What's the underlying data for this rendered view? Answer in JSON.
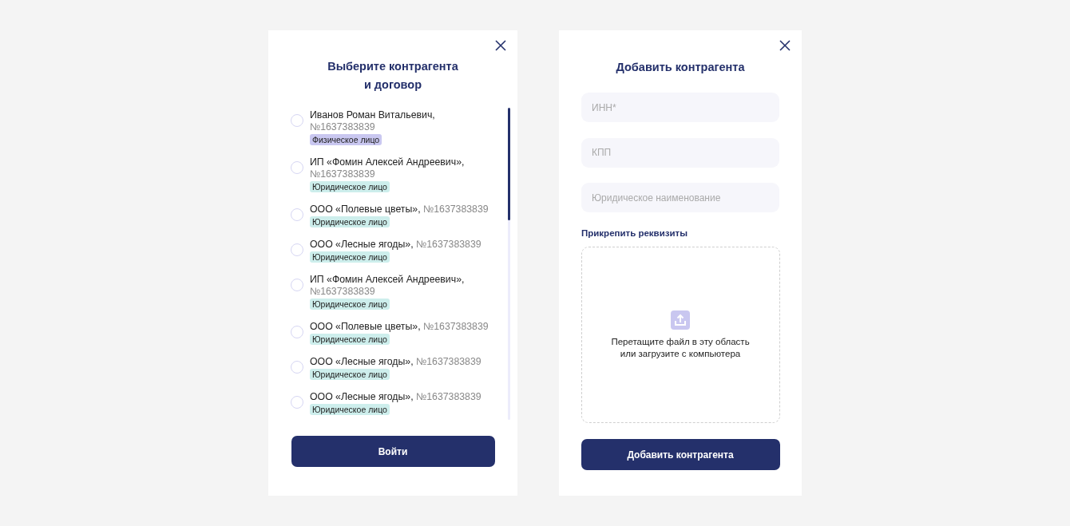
{
  "select_dialog": {
    "title_lines": [
      "Выберите контрагента",
      "и договор"
    ],
    "items": [
      {
        "name": "Иванов Роман Витальевич,",
        "number": "№1637383839",
        "tag": "Физическое лицо",
        "kind": "individual",
        "selected": false
      },
      {
        "name": "ИП «Фомин Алексей Андреевич»,",
        "number": "№1637383839",
        "tag": "Юридическое лицо",
        "kind": "legal",
        "selected": false
      },
      {
        "name": "ООО «Полевые цветы»,",
        "number": "№1637383839",
        "tag": "Юридическое лицо",
        "kind": "legal",
        "selected": false
      },
      {
        "name": "ООО «Лесные ягоды»,",
        "number": "№1637383839",
        "tag": "Юридическое лицо",
        "kind": "legal",
        "selected": false
      },
      {
        "name": "ИП «Фомин Алексей Андреевич»,",
        "number": "№1637383839",
        "tag": "Юридическое лицо",
        "kind": "legal",
        "selected": false
      },
      {
        "name": "ООО «Полевые цветы»,",
        "number": "№1637383839",
        "tag": "Юридическое лицо",
        "kind": "legal",
        "selected": false
      },
      {
        "name": "ООО «Лесные ягоды»,",
        "number": "№1637383839",
        "tag": "Юридическое лицо",
        "kind": "legal",
        "selected": false
      },
      {
        "name": "ООО «Лесные ягоды»,",
        "number": "№1637383839",
        "tag": "Юридическое лицо",
        "kind": "legal",
        "selected": false
      }
    ],
    "button": "Войти"
  },
  "add_dialog": {
    "title": "Добавить контрагента",
    "fields": [
      {
        "placeholder": "ИНН*"
      },
      {
        "placeholder": "КПП"
      },
      {
        "placeholder": "Юридическое наименование"
      }
    ],
    "attach_label": "Прикрепить реквизиты",
    "dropzone_lines": [
      "Перетащите файл в эту область",
      "или загрузите с компьютера"
    ],
    "button": "Добавить контрагента"
  }
}
